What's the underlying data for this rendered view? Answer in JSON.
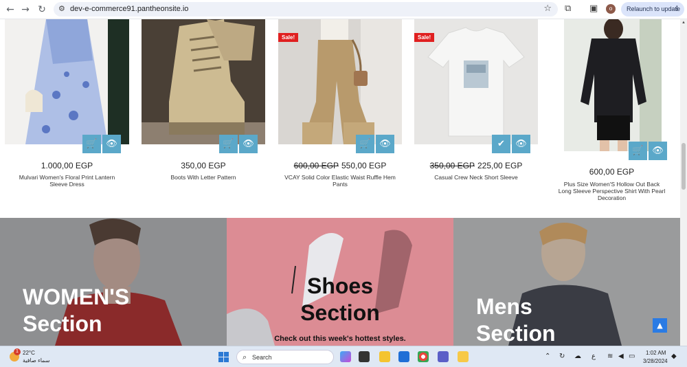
{
  "browser": {
    "url": "dev-e-commerce91.pantheonsite.io",
    "back_icon": "←",
    "forward_icon": "→",
    "reload_icon": "↻",
    "site_info_icon": "⚙",
    "star_icon": "☆",
    "extensions_icon": "⧉",
    "sidepanel_icon": "▣",
    "avatar_letter": "o",
    "relaunch_label": "Relaunch to update",
    "menu_icon": "⋮"
  },
  "products": [
    {
      "name": "Mulvari Women's Floral Print Lantern Sleeve Dress",
      "price": "1.000,00 EGP",
      "old_price": "",
      "sale": ""
    },
    {
      "name": "Boots With Letter Pattern",
      "price": "350,00 EGP",
      "old_price": "",
      "sale": ""
    },
    {
      "name": "VCAY Solid Color Elastic Waist Ruffle Hem Pants",
      "price": "550,00 EGP",
      "old_price": "600,00 EGP",
      "sale": "Sale!"
    },
    {
      "name": "Casual Crew Neck Short Sleeve",
      "price": "225,00 EGP",
      "old_price": "350,00 EGP",
      "sale": "Sale!"
    },
    {
      "name": "Plus Size Women'S Hollow Out Back Long Sleeve Perspective Shirt With Pearl Decoration",
      "price": "600,00 EGP",
      "old_price": "",
      "sale": ""
    }
  ],
  "icons": {
    "cart": "🛒",
    "eye": "👁",
    "check": "✔",
    "up": "▲"
  },
  "banners": {
    "women": {
      "line1": "WOMEN'S",
      "line2": "Section"
    },
    "shoes": {
      "line1": "Shoes",
      "line2": "Section",
      "tagline": "Check out this week's hottest styles."
    },
    "mens": {
      "line1": "Mens",
      "line2": "Section"
    }
  },
  "taskbar": {
    "weather_temp": "22°C",
    "weather_desc": "سماء صافية",
    "weather_badge": "1",
    "search_label": "Search",
    "time": "1:02 AM",
    "date": "3/28/2024",
    "lang": "ع"
  },
  "colors": {
    "accent": "#5ba8c9",
    "sale": "#e02020",
    "shoes_bg": "#e58c95"
  }
}
